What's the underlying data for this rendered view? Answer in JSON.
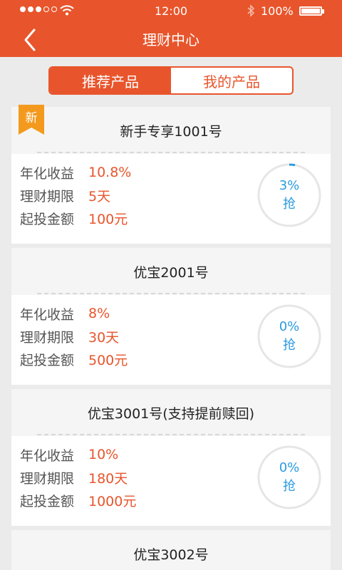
{
  "status_bar": {
    "time": "12:00",
    "battery": "100%"
  },
  "nav": {
    "title": "理财中心"
  },
  "tabs": [
    {
      "label": "推荐产品",
      "active": true
    },
    {
      "label": "我的产品",
      "active": false
    }
  ],
  "badge": "新",
  "products": [
    {
      "title": "新手专享1001号",
      "rate_label": "年化收益",
      "rate": "10.8%",
      "term_label": "理财期限",
      "term": "5天",
      "min_label": "起投金额",
      "min": "100元",
      "progress": "3%",
      "progress_value": 3,
      "action": "抢"
    },
    {
      "title": "优宝2001号",
      "rate_label": "年化收益",
      "rate": "8%",
      "term_label": "理财期限",
      "term": "30天",
      "min_label": "起投金额",
      "min": "500元",
      "progress": "0%",
      "progress_value": 0,
      "action": "抢"
    },
    {
      "title": "优宝3001号(支持提前赎回)",
      "rate_label": "年化收益",
      "rate": "10%",
      "term_label": "理财期限",
      "term": "180天",
      "min_label": "起投金额",
      "min": "1000元",
      "progress": "0%",
      "progress_value": 0,
      "action": "抢"
    },
    {
      "title": "优宝3002号"
    }
  ],
  "colors": {
    "accent": "#e8552c",
    "progress": "#2b9ae0",
    "ring_track": "#e6e6e6"
  },
  "icons": {
    "back": "chevron-left-icon",
    "wifi": "wifi-icon",
    "bluetooth": "bluetooth-icon",
    "battery": "battery-icon"
  }
}
